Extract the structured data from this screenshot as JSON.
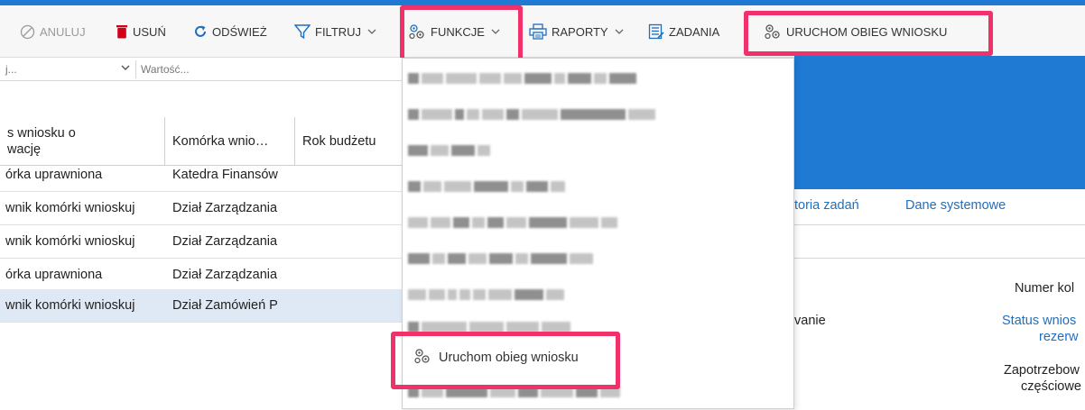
{
  "toolbar": {
    "cancel_label": "ANULUJ",
    "delete_label": "USUŃ",
    "refresh_label": "ODŚWIEŻ",
    "filter_label": "FILTRUJ",
    "functions_label": "FUNKCJE",
    "reports_label": "RAPORTY",
    "tasks_label": "ZADANIA",
    "run_workflow_label": "URUCHOM OBIEG WNIOSKU"
  },
  "filter": {
    "field_text": "j...",
    "value_placeholder": "Wartość..."
  },
  "grid": {
    "columns": [
      "s wniosku o\nwację",
      "Komórka wnio…",
      "Rok budżetu"
    ],
    "rows": [
      {
        "status": "órka uprawniona",
        "unit": "Katedra Finansów",
        "year": ""
      },
      {
        "status": "wnik komórki wnioskuj",
        "unit": "Dział Zarządzania",
        "year": ""
      },
      {
        "status": "wnik komórki wnioskuj",
        "unit": "Dział Zarządzania",
        "year": ""
      },
      {
        "status": "órka uprawniona",
        "unit": "Dział Zarządzania",
        "year": ""
      },
      {
        "status": "wnik komórki wnioskuj",
        "unit": "Dział Zamówień P",
        "year": ""
      }
    ]
  },
  "tabs": {
    "history": "toria zadań",
    "system": "Dane systemowe"
  },
  "details": {
    "number_label": "Numer kol",
    "status_label_1": "Status wnios",
    "status_label_2": "rezerw",
    "demand_label_1": "Zapotrzebow",
    "demand_label_2": "częściowe",
    "value_fragment": "vanie"
  },
  "menu": {
    "run_workflow_item": "Uruchom obieg wniosku"
  },
  "colors": {
    "accent_blue": "#1f7ad4",
    "highlight": "#f0316a",
    "delete_red": "#d0021b",
    "selected_row": "#dfe9f5"
  }
}
